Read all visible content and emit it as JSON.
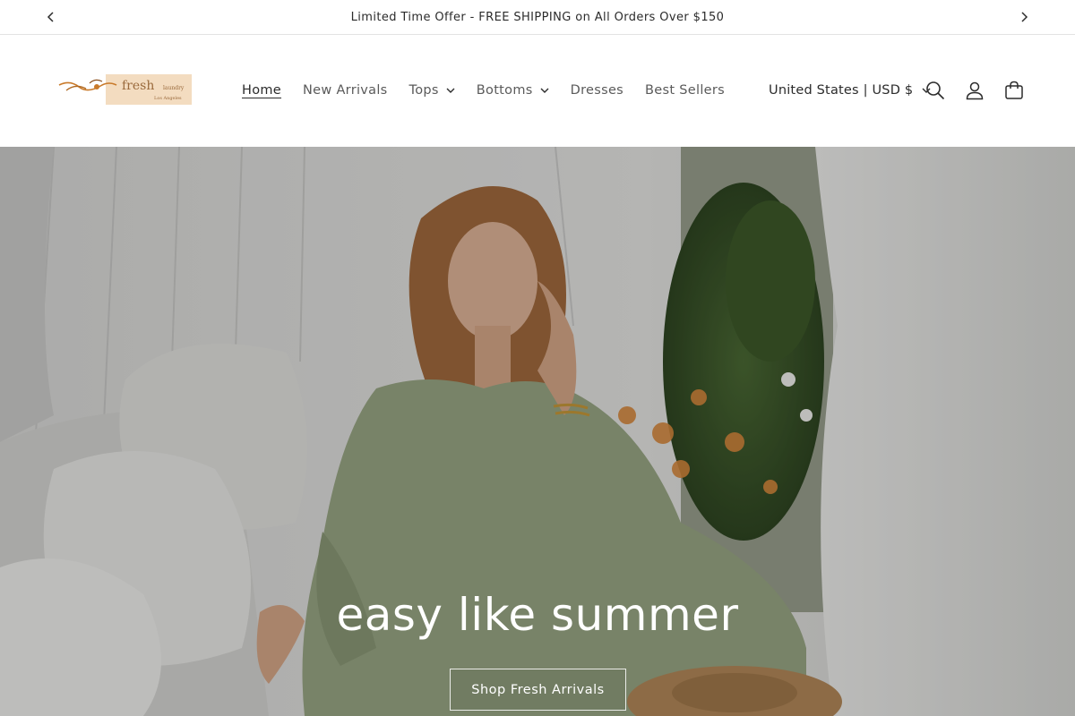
{
  "announcement": {
    "text": "Limited Time Offer - FREE SHIPPING on All Orders Over $150",
    "prev_icon": "chevron-left-icon",
    "next_icon": "chevron-right-icon"
  },
  "logo": {
    "wordmark": "fresh",
    "sub": "laundry",
    "city": "Los Angeles"
  },
  "nav": {
    "items": [
      {
        "label": "Home",
        "active": true,
        "dropdown": false
      },
      {
        "label": "New Arrivals",
        "active": false,
        "dropdown": false
      },
      {
        "label": "Tops",
        "active": false,
        "dropdown": true
      },
      {
        "label": "Bottoms",
        "active": false,
        "dropdown": true
      },
      {
        "label": "Dresses",
        "active": false,
        "dropdown": false
      },
      {
        "label": "Best Sellers",
        "active": false,
        "dropdown": false
      }
    ]
  },
  "header": {
    "country_label": "United States | USD $",
    "icons": [
      "search-icon",
      "account-icon",
      "cart-icon"
    ]
  },
  "hero": {
    "heading": "easy like summer",
    "cta_label": "Shop Fresh Arrivals"
  },
  "colors": {
    "text": "#2b2b2b",
    "muted": "#5a5a5a",
    "logo_bg": "#f3dcc0",
    "dress": "#9aa886",
    "hair": "#a36b3e"
  }
}
